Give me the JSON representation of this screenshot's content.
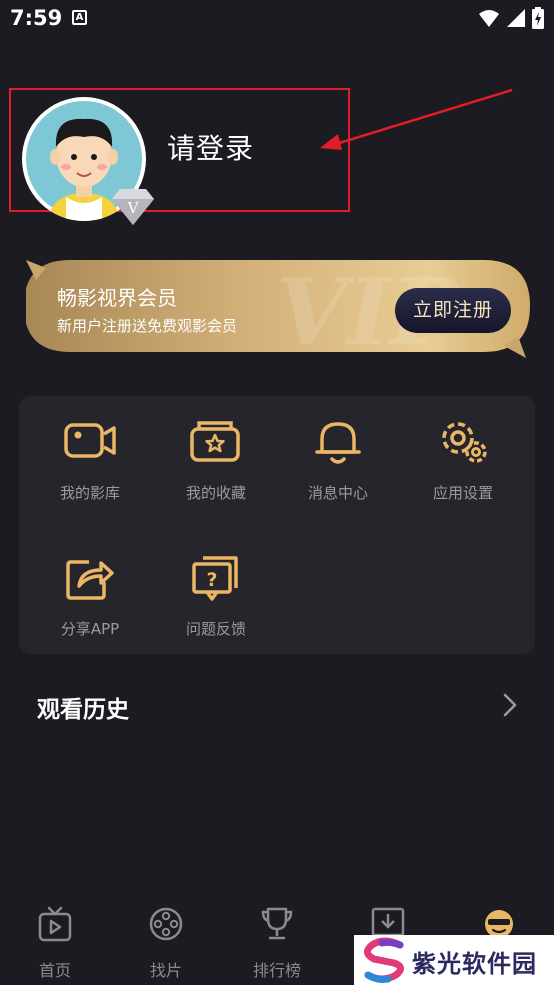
{
  "status_bar": {
    "time": "7:59",
    "notification_glyph": "A"
  },
  "profile": {
    "login_text": "请登录",
    "vip_badge_letter": "V"
  },
  "vip_banner": {
    "title": "畅影视界会员",
    "subtitle": "新用户注册送免费观影会员",
    "register_label": "立即注册",
    "watermark_letters": "VIP"
  },
  "functions": [
    {
      "label": "我的影库",
      "icon": "video-camera-icon"
    },
    {
      "label": "我的收藏",
      "icon": "star-folder-icon"
    },
    {
      "label": "消息中心",
      "icon": "bell-icon"
    },
    {
      "label": "应用设置",
      "icon": "gear-icon"
    },
    {
      "label": "分享APP",
      "icon": "share-icon"
    },
    {
      "label": "问题反馈",
      "icon": "question-icon"
    }
  ],
  "history": {
    "title": "观看历史"
  },
  "bottom_nav": [
    {
      "label": "首页",
      "icon": "tv-icon"
    },
    {
      "label": "找片",
      "icon": "film-reel-icon"
    },
    {
      "label": "排行榜",
      "icon": "trophy-icon"
    },
    {
      "label": "",
      "icon": "download-icon"
    },
    {
      "label": "",
      "icon": "cool-face-icon",
      "active": true
    }
  ],
  "watermark": {
    "text": "紫光软件园"
  },
  "colors": {
    "background": "#1c1b22",
    "card": "#26252c",
    "accent_gold": "#e9b765",
    "annotation_red": "#e01e2a"
  }
}
